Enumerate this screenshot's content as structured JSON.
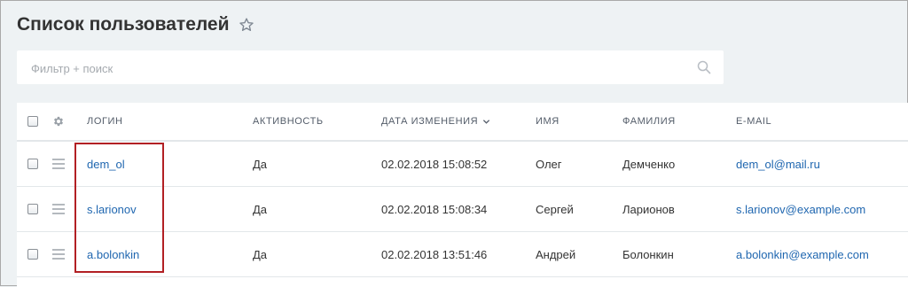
{
  "page": {
    "title": "Список пользователей"
  },
  "filter": {
    "placeholder": "Фильтр + поиск",
    "value": ""
  },
  "grid": {
    "columns": {
      "login": "ЛОГИН",
      "active": "АКТИВНОСТЬ",
      "date": "ДАТА ИЗМЕНЕНИЯ",
      "name": "ИМЯ",
      "last_name": "ФАМИЛИЯ",
      "email": "E-MAIL"
    },
    "sort": {
      "column": "date",
      "direction": "desc"
    },
    "rows": [
      {
        "login": "dem_ol",
        "active": "Да",
        "date": "02.02.2018 15:08:52",
        "name": "Олег",
        "last_name": "Демченко",
        "email": "dem_ol@mail.ru"
      },
      {
        "login": "s.larionov",
        "active": "Да",
        "date": "02.02.2018 15:08:34",
        "name": "Сергей",
        "last_name": "Ларионов",
        "email": "s.larionov@example.com"
      },
      {
        "login": "a.bolonkin",
        "active": "Да",
        "date": "02.02.2018 13:51:46",
        "name": "Андрей",
        "last_name": "Болонкин",
        "email": "a.bolonkin@example.com"
      }
    ]
  },
  "icons": {
    "star": "star-icon",
    "search": "search-icon",
    "settings": "gear-icon",
    "row_menu": "menu-icon",
    "sort": "chevron-down-icon"
  },
  "colors": {
    "background": "#eef2f4",
    "link": "#2067b0",
    "highlight": "#b22024"
  }
}
